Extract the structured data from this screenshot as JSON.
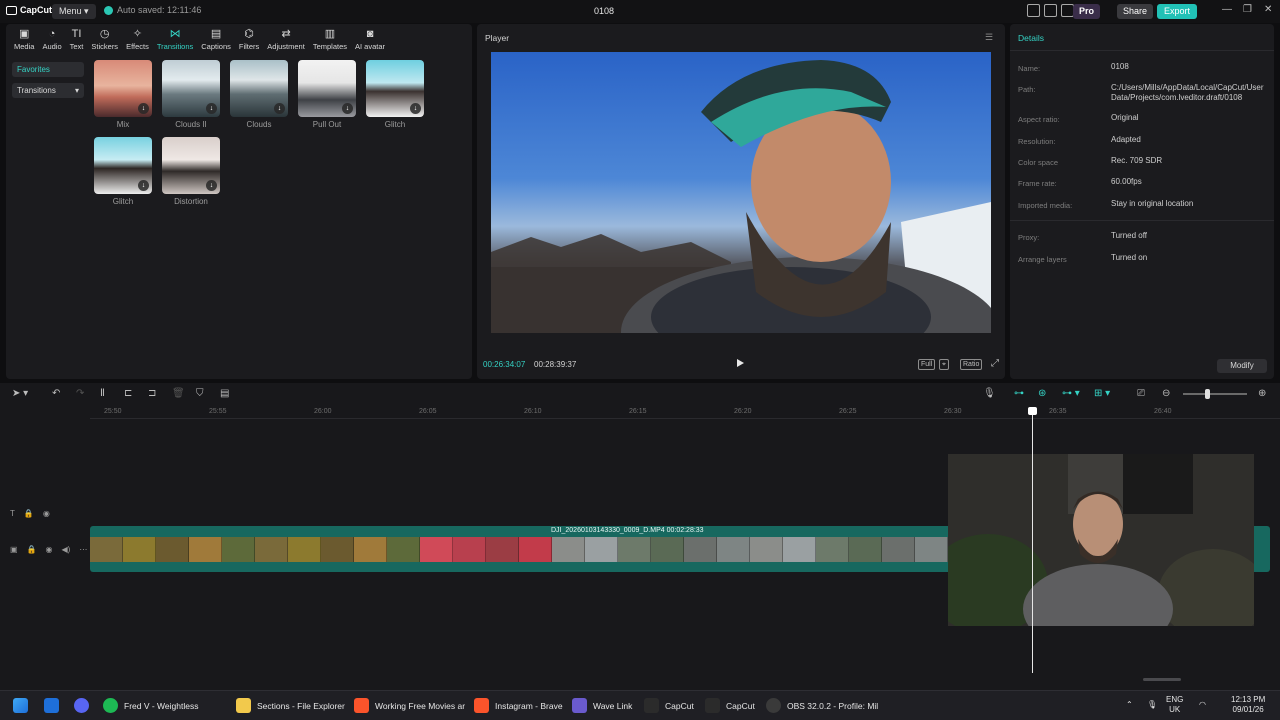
{
  "titlebar": {
    "logo": "CapCut",
    "menu": "Menu",
    "autosave": "Auto saved: 12:11:46",
    "project": "0108",
    "pro": "Pro",
    "share": "Share",
    "export": "Export"
  },
  "tools": [
    {
      "label": "Media",
      "icon": "▣"
    },
    {
      "label": "Audio",
      "icon": "◔"
    },
    {
      "label": "Text",
      "icon": "TI"
    },
    {
      "label": "Stickers",
      "icon": "◷"
    },
    {
      "label": "Effects",
      "icon": "✧"
    },
    {
      "label": "Transitions",
      "icon": "⋈"
    },
    {
      "label": "Captions",
      "icon": "▤"
    },
    {
      "label": "Filters",
      "icon": "⌬"
    },
    {
      "label": "Adjustment",
      "icon": "⇄"
    },
    {
      "label": "Templates",
      "icon": "▥"
    },
    {
      "label": "AI avatar",
      "icon": "◙"
    }
  ],
  "sidebar": {
    "favorites": "Favorites",
    "transitions": "Transitions"
  },
  "transitions": [
    {
      "label": "Mix"
    },
    {
      "label": "Clouds II"
    },
    {
      "label": "Clouds"
    },
    {
      "label": "Pull Out"
    },
    {
      "label": "Glitch"
    },
    {
      "label": "Glitch"
    },
    {
      "label": "Distortion"
    }
  ],
  "player": {
    "title": "Player",
    "current_time": "00:26:34:07",
    "total_time": "00:28:39:37",
    "full_label": "Full",
    "ratio_label": "Ratio"
  },
  "details": {
    "title": "Details",
    "rows": [
      {
        "label": "Name:",
        "value": "0108"
      },
      {
        "label": "Path:",
        "value": "C:/Users/Mills/AppData/Local/CapCut/User Data/Projects/com.lveditor.draft/0108"
      },
      {
        "label": "Aspect ratio:",
        "value": "Original"
      },
      {
        "label": "Resolution:",
        "value": "Adapted"
      },
      {
        "label": "Color space",
        "value": "Rec. 709 SDR"
      },
      {
        "label": "Frame rate:",
        "value": "60.00fps"
      },
      {
        "label": "Imported media:",
        "value": "Stay in original location"
      },
      {
        "label": "Proxy:",
        "value": "Turned off"
      },
      {
        "label": "Arrange layers",
        "value": "Turned on"
      }
    ],
    "modify": "Modify"
  },
  "timeline": {
    "ticks": [
      "25:50",
      "25:55",
      "26:00",
      "26:05",
      "26:10",
      "26:15",
      "26:20",
      "26:25",
      "26:30",
      "26:35",
      "26:40"
    ],
    "clip_label": "DJI_20260103143330_0009_D.MP4   00:02:28:33"
  },
  "taskbar": {
    "items": [
      {
        "label": "Fred V - Weightless"
      },
      {
        "label": "Sections - File Explorer"
      },
      {
        "label": "Working Free Movies ar"
      },
      {
        "label": "Instagram - Brave"
      },
      {
        "label": "Wave Link"
      },
      {
        "label": "CapCut"
      },
      {
        "label": "CapCut"
      },
      {
        "label": "OBS 32.0.2 - Profile: Mil"
      }
    ],
    "lang_1": "ENG",
    "lang_2": "UK",
    "time": "12:13 PM",
    "date": "09/01/26"
  },
  "colors": {
    "accent": "#35d3c5",
    "export": "#21c1b6",
    "clip": "#17685f"
  }
}
